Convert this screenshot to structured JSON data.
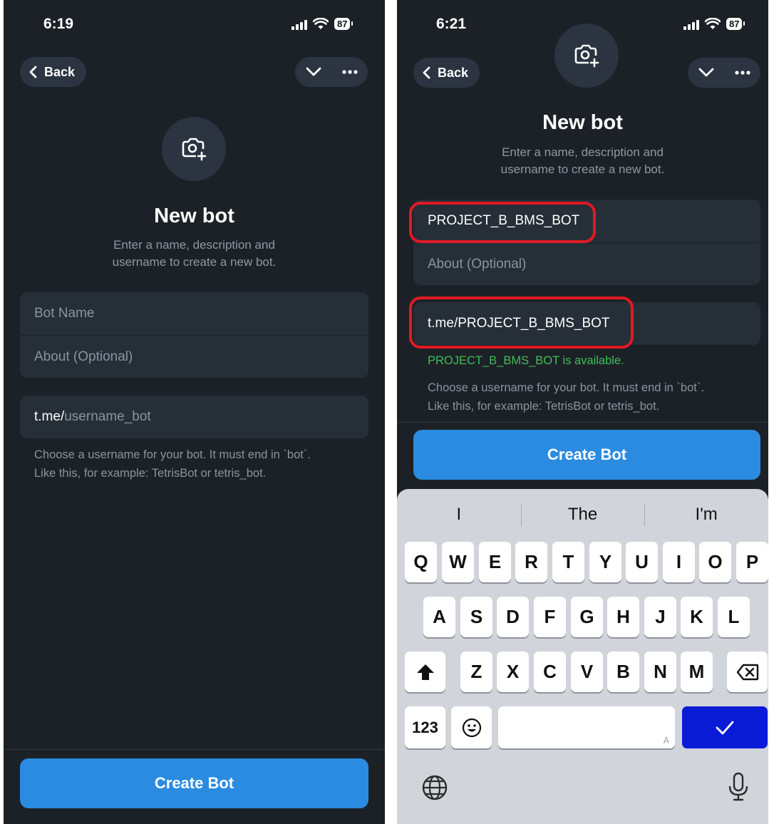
{
  "left": {
    "time": "6:19",
    "battery": "87",
    "back_label": "Back",
    "title": "New bot",
    "subtitle_line1": "Enter a name, description and",
    "subtitle_line2": "username to create a new bot.",
    "bot_name_placeholder": "Bot Name",
    "about_placeholder": "About (Optional)",
    "username_prefix": "t.me/",
    "username_placeholder": "username_bot",
    "hint_line1": "Choose a username for your bot. It must end in `bot`.",
    "hint_line2": "Like this, for example: TetrisBot or tetris_bot.",
    "create_button": "Create Bot"
  },
  "right": {
    "time": "6:21",
    "battery": "87",
    "back_label": "Back",
    "title": "New bot",
    "subtitle_line1": "Enter a name, description and",
    "subtitle_line2": "username to create a new bot.",
    "bot_name_value": "PROJECT_B_BMS_BOT",
    "about_placeholder": "About (Optional)",
    "username_value": "t.me/PROJECT_B_BMS_BOT",
    "availability": "PROJECT_B_BMS_BOT is available.",
    "hint_line1": "Choose a username for your bot. It must end in `bot`.",
    "hint_line2": "Like this, for example: TetrisBot or tetris_bot.",
    "create_button": "Create Bot",
    "keyboard": {
      "suggestions": [
        "I",
        "The",
        "I'm"
      ],
      "row1": [
        "Q",
        "W",
        "E",
        "R",
        "T",
        "Y",
        "U",
        "I",
        "O",
        "P"
      ],
      "row2": [
        "A",
        "S",
        "D",
        "F",
        "G",
        "H",
        "J",
        "K",
        "L"
      ],
      "row3": [
        "Z",
        "X",
        "C",
        "V",
        "B",
        "N",
        "M"
      ],
      "numbers_key": "123",
      "space_mark": "A"
    }
  },
  "colors": {
    "background": "#1c2127",
    "field": "#262e38",
    "accent": "#2a8be0",
    "available": "#3fbf5a",
    "highlight": "#e01a23",
    "done_key": "#0a1bd6"
  },
  "icons": [
    "camera-add-icon",
    "chevron-left-icon",
    "chevron-down-icon",
    "more-dots-icon",
    "signal-icon",
    "wifi-icon",
    "battery-icon",
    "shift-icon",
    "backspace-icon",
    "emoji-icon",
    "globe-icon",
    "mic-icon",
    "checkmark-icon"
  ]
}
